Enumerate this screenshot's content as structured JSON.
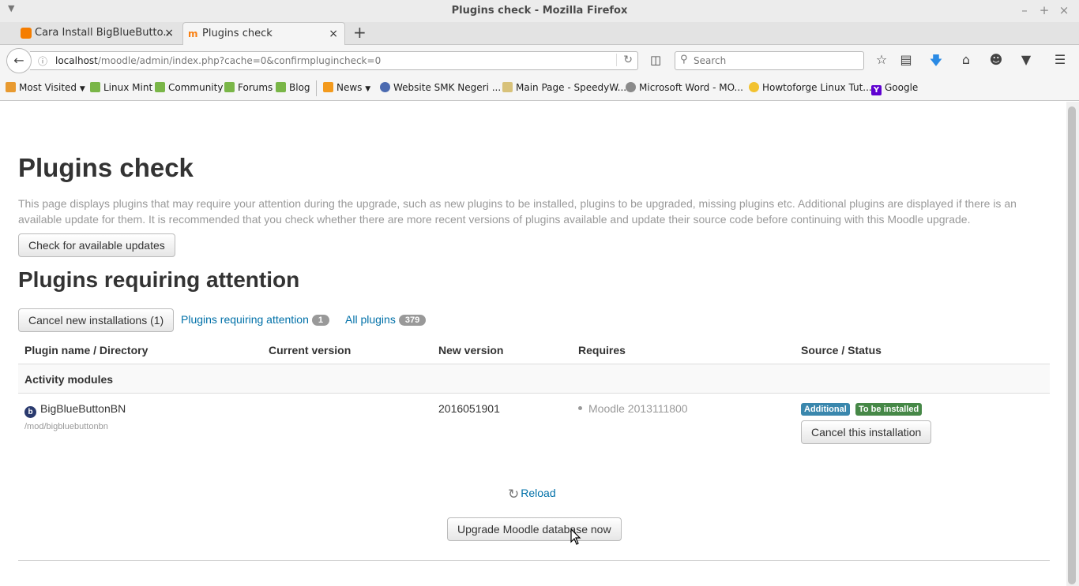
{
  "window": {
    "title": "Plugins check - Mozilla Firefox"
  },
  "tabs": [
    {
      "label": "Cara Install BigBlueButto...",
      "active": false,
      "icon": "blogger-icon"
    },
    {
      "label": "Plugins check",
      "active": true,
      "icon": "moodle-icon"
    }
  ],
  "navbar": {
    "url_host": "localhost",
    "url_path": "/moodle/admin/index.php?cache=0&confirmplugincheck=0",
    "search_placeholder": "Search"
  },
  "bookmarks": [
    {
      "label": "Most Visited",
      "dropdown": true,
      "icon": "folder-icon"
    },
    {
      "label": "Linux Mint",
      "icon": "mint-icon"
    },
    {
      "label": "Community",
      "icon": "mint-icon"
    },
    {
      "label": "Forums",
      "icon": "mint-icon"
    },
    {
      "label": "Blog",
      "icon": "mint-icon"
    },
    {
      "label": "News",
      "dropdown": true,
      "icon": "rss-icon"
    },
    {
      "label": "Website SMK Negeri ...",
      "icon": "school-icon"
    },
    {
      "label": "Main Page - SpeedyW...",
      "icon": "page-icon"
    },
    {
      "label": "Microsoft Word - MO...",
      "icon": "globe-icon"
    },
    {
      "label": "Howtoforge Linux Tut...",
      "icon": "bulb-icon"
    },
    {
      "label": "Google",
      "icon": "yahoo-icon"
    }
  ],
  "page": {
    "title": "Plugins check",
    "description": "This page displays plugins that may require your attention during the upgrade, such as new plugins to be installed, plugins to be upgraded, missing plugins etc. Additional plugins are displayed if there is an available update for them. It is recommended that you check whether there are more recent versions of plugins available and update their source code before continuing with this Moodle upgrade.",
    "check_updates_label": "Check for available updates",
    "section_title": "Plugins requiring attention",
    "cancel_new_label": "Cancel new installations (1)",
    "filter_attention_label": "Plugins requiring attention",
    "filter_attention_count": "1",
    "filter_all_label": "All plugins",
    "filter_all_count": "379"
  },
  "table": {
    "headers": [
      "Plugin name / Directory",
      "Current version",
      "New version",
      "Requires",
      "Source / Status"
    ],
    "group": "Activity modules",
    "plugin": {
      "name": "BigBlueButtonBN",
      "directory": "/mod/bigbluebuttonbn",
      "current_version": "",
      "new_version": "2016051901",
      "requires": "Moodle 2013111800",
      "badge_source": "Additional",
      "badge_status": "To be installed",
      "cancel_label": "Cancel this installation"
    }
  },
  "footer": {
    "reload_label": "Reload",
    "upgrade_label": "Upgrade Moodle database now"
  },
  "colors": {
    "link": "#0070a8",
    "badge_additional": "#3a87ad",
    "badge_to_install": "#468847",
    "count_badge": "#999999"
  }
}
